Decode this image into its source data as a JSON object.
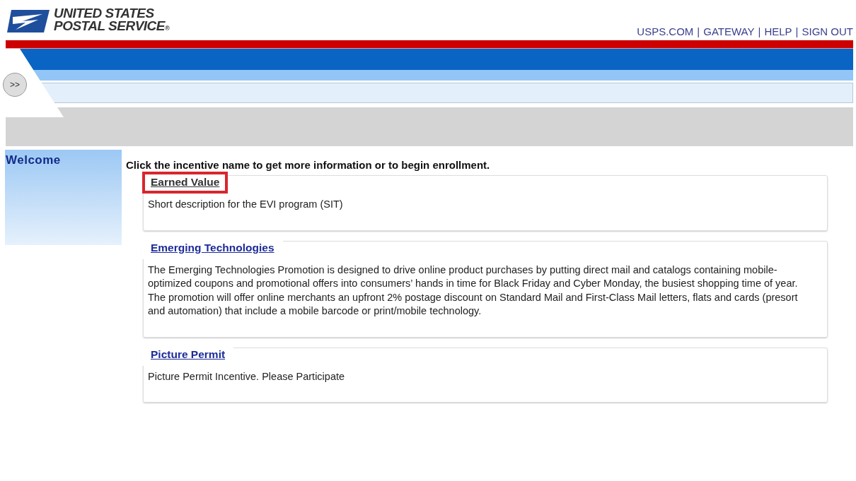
{
  "header": {
    "logo_lines": [
      "UNITED STATES",
      "POSTAL SERVICE"
    ],
    "logo_mark": "®",
    "nav_links": [
      "USPS.COM",
      "GATEWAY",
      "HELP",
      "SIGN OUT"
    ],
    "nav_separator": "|"
  },
  "toolbar": {
    "expand_button": ">>"
  },
  "sidebar": {
    "title": "Welcome"
  },
  "main": {
    "instruction": "Click the incentive name to get more information or to begin enrollment.",
    "incentives": [
      {
        "name": "Earned Value",
        "description": "Short description for the EVI program (SIT)",
        "highlighted": true
      },
      {
        "name": "Emerging Technologies",
        "description": "The Emerging Technologies Promotion is designed to drive online product purchases by putting direct mail and catalogs containing mobile-optimized coupons and promotional offers into consumers’ hands in time for Black Friday and Cyber Monday, the busiest shopping time of year. The promotion will offer online merchants  an upfront 2% postage discount on Standard Mail and First-Class  Mail letters, flats and cards (presort and automation) that include a mobile barcode or print/mobile technology.",
        "highlighted": false
      },
      {
        "name": "Picture Permit",
        "description": "Picture Permit Incentive. Please Participate",
        "highlighted": false
      }
    ]
  }
}
